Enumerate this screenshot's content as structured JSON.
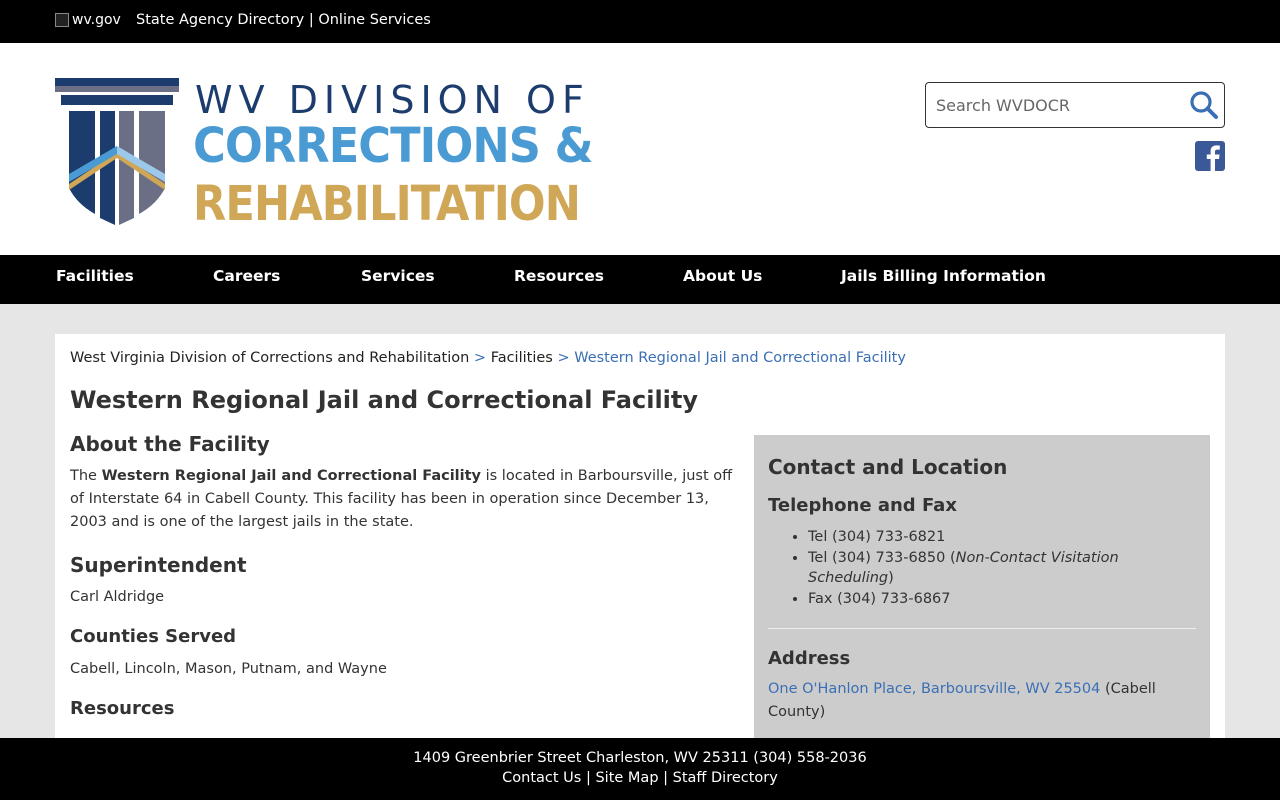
{
  "topbar": {
    "wvgov_alt": "wv.gov",
    "directory_link": "State Agency Directory",
    "separator": "|",
    "online_services_link": "Online Services"
  },
  "header": {
    "logo_line1": "WV DIVISION OF",
    "logo_line2": "CORRECTIONS &",
    "logo_line3": "REHABILITATION",
    "search_placeholder": "Search WVDOCR"
  },
  "nav": {
    "items": [
      "Facilities",
      "Careers",
      "Services",
      "Resources",
      "About Us",
      "Jails Billing Information"
    ]
  },
  "breadcrumb": {
    "root": "West Virginia Division of Corrections and Rehabilitation",
    "sep": ">",
    "middle": "Facilities",
    "current": "Western Regional Jail and Correctional Facility"
  },
  "page": {
    "title": "Western Regional Jail and Correctional Facility",
    "about_heading": "About the Facility",
    "about_prefix": "The",
    "about_bold": "Western Regional Jail and Correctional Facility",
    "about_rest": "is located in Barboursville, just off of Interstate 64 in Cabell County. This facility has been in operation since December 13, 2003 and is one of the largest jails in the state.",
    "superintendent_heading": "Superintendent",
    "superintendent_name": "Carl Aldridge",
    "counties_heading": "Counties Served",
    "counties_list": "Cabell, Lincoln, Mason, Putnam, and Wayne",
    "resources_heading": "Resources"
  },
  "contact": {
    "heading": "Contact and Location",
    "tel_heading": "Telephone and Fax",
    "tel1": "Tel (304) 733-6821",
    "tel2_prefix": "Tel (304) 733-6850 (",
    "tel2_note": "Non-Contact Visitation Scheduling",
    "tel2_suffix": ")",
    "fax": "Fax (304) 733-6867",
    "address_heading": "Address",
    "address_link": "One O'Hanlon Place, Barboursville, WV 25504",
    "address_county": "(Cabell County)"
  },
  "footer": {
    "address_line": "1409 Greenbrier Street Charleston, WV 25311 (304) 558-2036",
    "contact_link": "Contact Us",
    "sep": "|",
    "sitemap_link": "Site Map",
    "staff_link": "Staff Directory"
  },
  "colors": {
    "logo_navy": "#1d3c6e",
    "logo_blue": "#4a9bd3",
    "logo_gold": "#cfa757",
    "link_blue": "#3a6fb5",
    "facebook_blue": "#3b5998",
    "sidebar_gray": "#cccccc"
  }
}
